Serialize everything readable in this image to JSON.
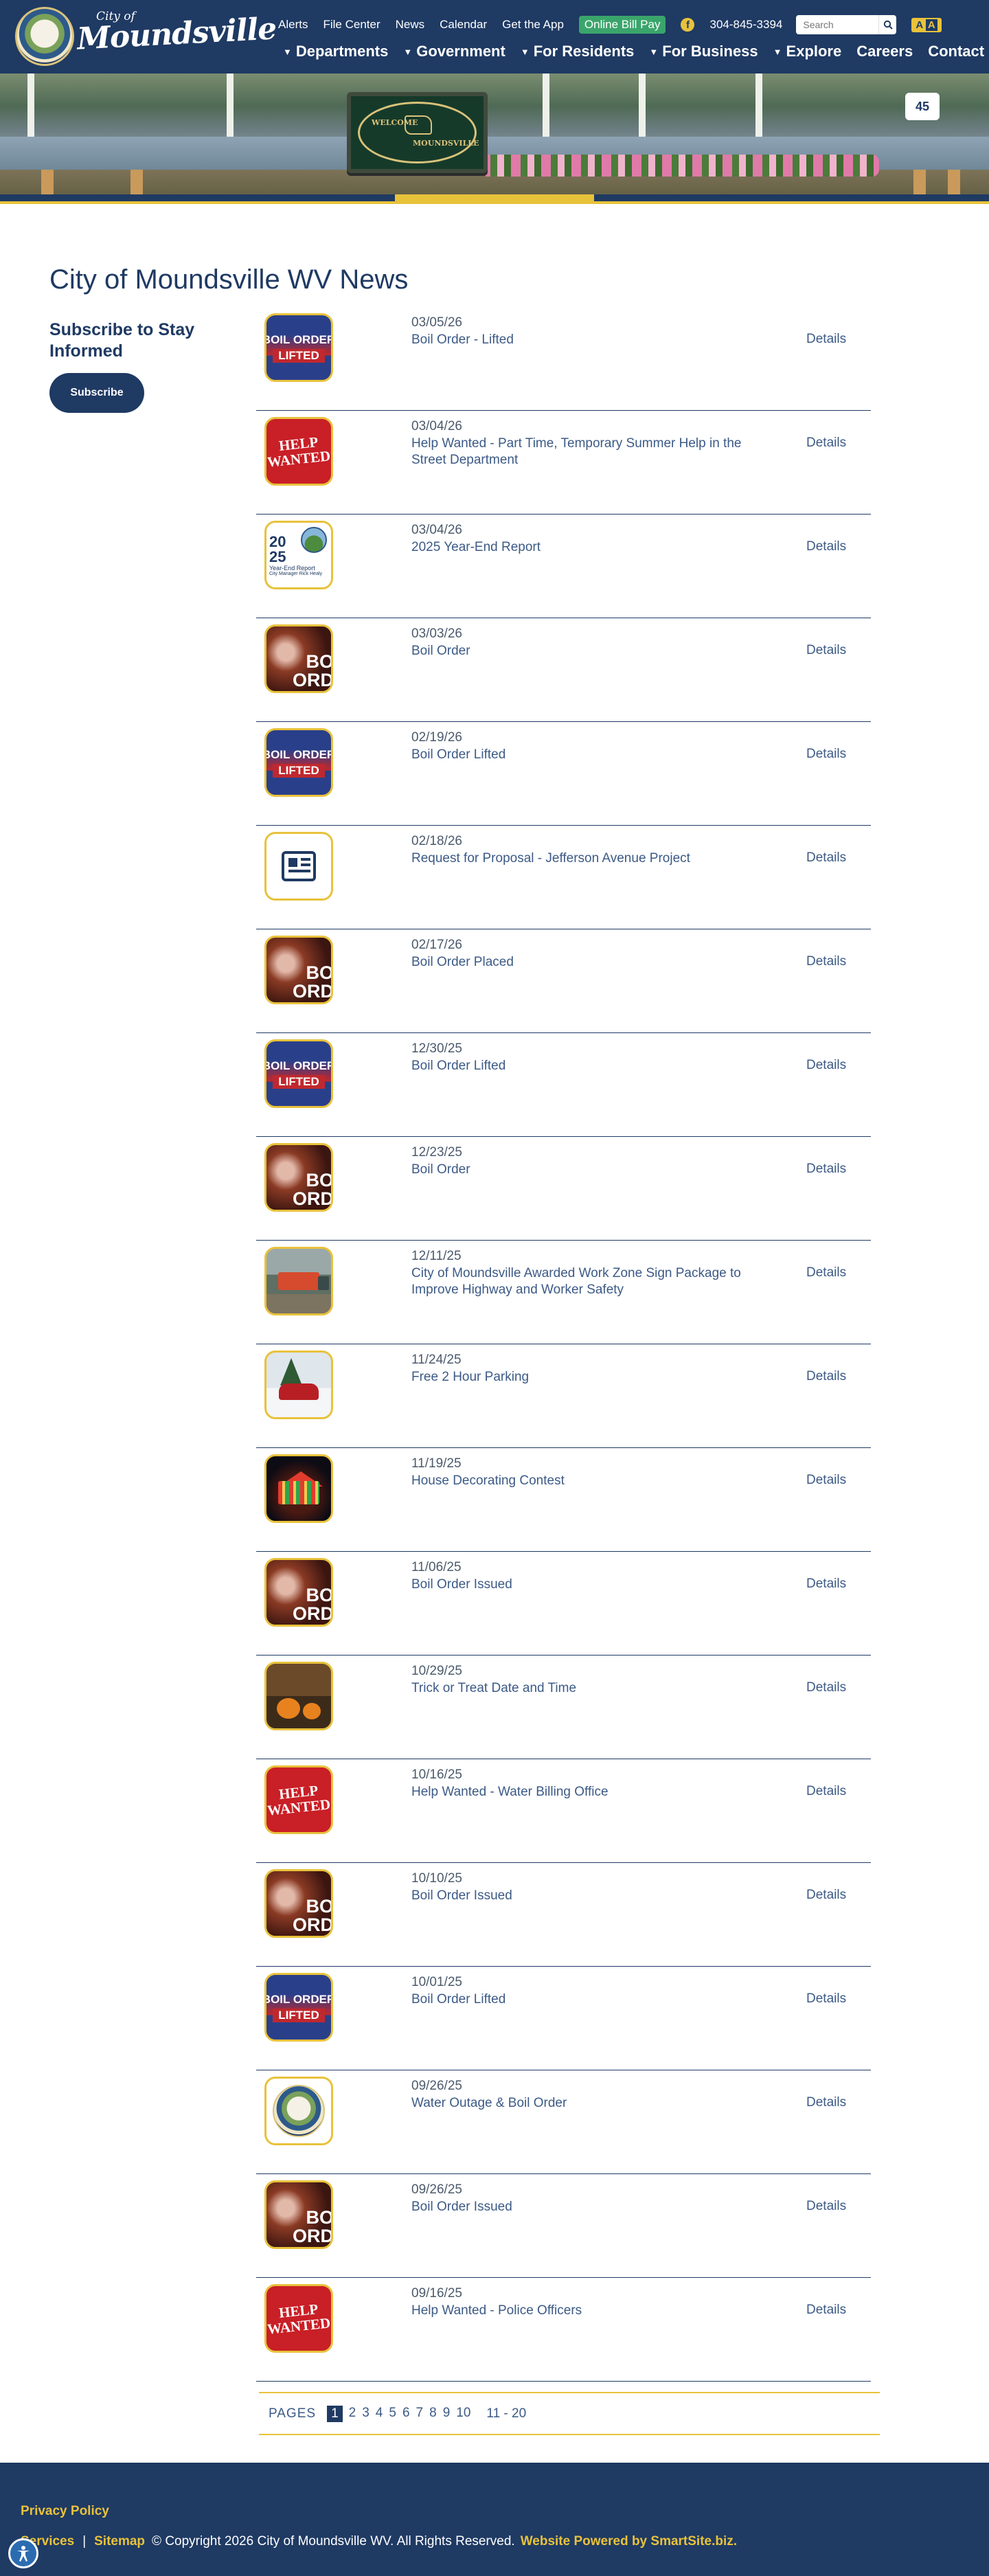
{
  "header": {
    "logo_small": "City of",
    "logo_text": "Moundsville",
    "utility_links": [
      "Alerts",
      "File Center",
      "News",
      "Calendar",
      "Get the App"
    ],
    "bill_pay": "Online Bill Pay",
    "facebook_icon": "facebook-icon",
    "phone": "304-845-3394",
    "search_placeholder": "Search",
    "a11y_text": "A",
    "nav": [
      "Departments",
      "Government",
      "For Residents",
      "For Business",
      "Explore",
      "Careers",
      "Contact"
    ]
  },
  "banner": {
    "sign_line1": "WELCOME",
    "sign_line2": "MOUNDSVILLE",
    "route_number": "45"
  },
  "page_title": "City of Moundsville WV News",
  "sidebar": {
    "heading": "Subscribe to Stay Informed",
    "button": "Subscribe"
  },
  "news": [
    {
      "date": "03/05/26",
      "title": "Boil Order - Lifted",
      "details": "Details"
    },
    {
      "date": "03/04/26",
      "title": "Help Wanted - Part Time, Temporary Summer Help in the Street Department",
      "details": "Details"
    },
    {
      "date": "03/04/26",
      "title": "2025 Year-End Report",
      "details": "Details"
    },
    {
      "date": "03/03/26",
      "title": "Boil Order",
      "details": "Details"
    },
    {
      "date": "02/19/26",
      "title": "Boil Order Lifted",
      "details": "Details"
    },
    {
      "date": "02/18/26",
      "title": "Request for Proposal - Jefferson Avenue Project",
      "details": "Details"
    },
    {
      "date": "02/17/26",
      "title": "Boil Order Placed",
      "details": "Details"
    },
    {
      "date": "12/30/25",
      "title": "Boil Order Lifted",
      "details": "Details"
    },
    {
      "date": "12/23/25",
      "title": "Boil Order",
      "details": "Details"
    },
    {
      "date": "12/11/25",
      "title": "City of Moundsville Awarded Work Zone Sign Package to Improve Highway and Worker Safety",
      "details": "Details"
    },
    {
      "date": "11/24/25",
      "title": "Free 2 Hour Parking",
      "details": "Details"
    },
    {
      "date": "11/19/25",
      "title": "House Decorating Contest",
      "details": "Details"
    },
    {
      "date": "11/06/25",
      "title": "Boil Order Issued",
      "details": "Details"
    },
    {
      "date": "10/29/25",
      "title": "Trick or Treat Date and Time",
      "details": "Details"
    },
    {
      "date": "10/16/25",
      "title": "Help Wanted - Water Billing Office",
      "details": "Details"
    },
    {
      "date": "10/10/25",
      "title": "Boil Order Issued",
      "details": "Details"
    },
    {
      "date": "10/01/25",
      "title": "Boil Order Lifted",
      "details": "Details"
    },
    {
      "date": "09/26/25",
      "title": "Water Outage & Boil Order",
      "details": "Details"
    },
    {
      "date": "09/26/25",
      "title": "Boil Order Issued",
      "details": "Details"
    },
    {
      "date": "09/16/25",
      "title": "Help Wanted - Police Officers",
      "details": "Details"
    }
  ],
  "thumb_text": {
    "lifted_1": "BOIL ORDER",
    "lifted_2": "LIFTED",
    "help_1": "HELP",
    "help_2": "WANTED",
    "boil_1": "BO",
    "boil_2": "ORD",
    "report_1": "20",
    "report_2": "25",
    "report_3": "Year-End Report",
    "report_4": "City Manager Rick Healy"
  },
  "pagination": {
    "label": "PAGES",
    "pages": [
      "1",
      "2",
      "3",
      "4",
      "5",
      "6",
      "7",
      "8",
      "9",
      "10"
    ],
    "current": "1",
    "next_range": "11 - 20"
  },
  "footer": {
    "privacy": "Privacy Policy",
    "services": "Services",
    "sep": "|",
    "sitemap": "Sitemap",
    "copyright": "© Copyright 2026 City of Moundsville WV.  All Rights Reserved.",
    "powered": "Website Powered by SmartSite.biz."
  },
  "colors": {
    "navy": "#1f3a63",
    "gold": "#e8c23b",
    "bill_pay_green": "#3aa56b",
    "link_blue": "#3c5a86"
  }
}
